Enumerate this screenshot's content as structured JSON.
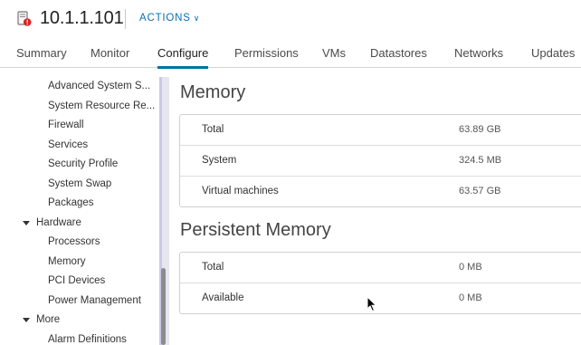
{
  "header": {
    "title": "10.1.1.101",
    "actions_label": "ACTIONS"
  },
  "tabs": [
    {
      "label": "Summary"
    },
    {
      "label": "Monitor"
    },
    {
      "label": "Configure",
      "active": true
    },
    {
      "label": "Permissions"
    },
    {
      "label": "VMs"
    },
    {
      "label": "Datastores"
    },
    {
      "label": "Networks"
    },
    {
      "label": "Updates"
    }
  ],
  "sidebar": {
    "items": [
      {
        "label": "Advanced System S..."
      },
      {
        "label": "System Resource Re..."
      },
      {
        "label": "Firewall"
      },
      {
        "label": "Services"
      },
      {
        "label": "Security Profile"
      },
      {
        "label": "System Swap"
      },
      {
        "label": "Packages"
      }
    ],
    "hardware_label": "Hardware",
    "hardware_items": [
      {
        "label": "Processors"
      },
      {
        "label": "Memory"
      },
      {
        "label": "PCI Devices"
      },
      {
        "label": "Power Management"
      }
    ],
    "more_label": "More",
    "more_items": [
      {
        "label": "Alarm Definitions"
      }
    ]
  },
  "memory": {
    "title": "Memory",
    "rows": [
      {
        "label": "Total",
        "value": "63.89 GB"
      },
      {
        "label": "System",
        "value": "324.5 MB"
      },
      {
        "label": "Virtual machines",
        "value": "63.57 GB"
      }
    ]
  },
  "persistent_memory": {
    "title": "Persistent Memory",
    "rows": [
      {
        "label": "Total",
        "value": "0 MB"
      },
      {
        "label": "Available",
        "value": "0 MB"
      }
    ]
  },
  "colors": {
    "accent": "#0072a3",
    "link": "#0a6fb3",
    "alert": "#e02020"
  }
}
